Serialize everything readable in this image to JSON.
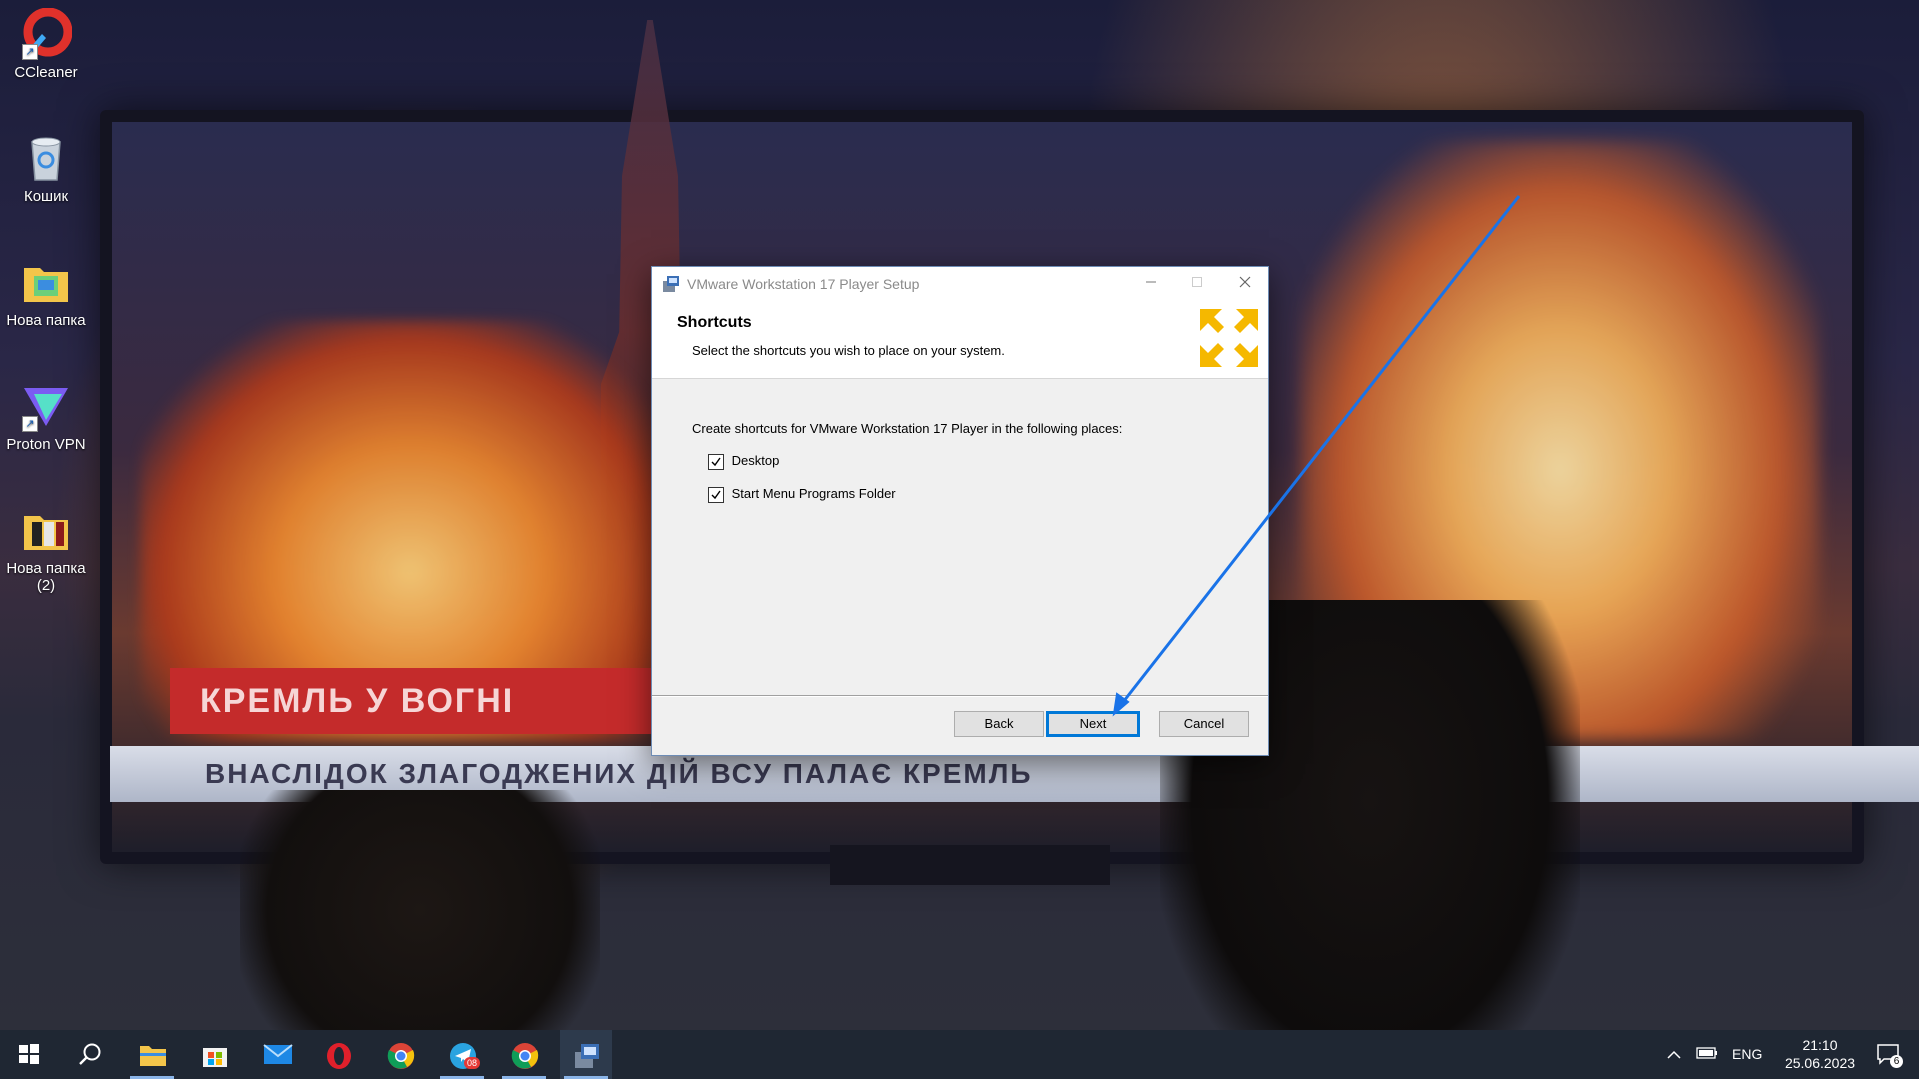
{
  "desktop": {
    "icons": [
      {
        "label": "CCleaner",
        "icon": "ccleaner-icon"
      },
      {
        "label": "Кошик",
        "icon": "recycle-bin-icon"
      },
      {
        "label": "Нова папка",
        "icon": "folder-icon"
      },
      {
        "label": "Proton VPN",
        "icon": "proton-vpn-icon"
      },
      {
        "label": "Нова папка (2)",
        "icon": "folder-icon"
      }
    ],
    "wallpaper": {
      "banner": "КРЕМЛЬ У ВОГНІ",
      "ticker": "ВНАСЛІДОК ЗЛАГОДЖЕНИХ ДІЙ ВСУ ПАЛАЄ КРЕМЛЬ"
    }
  },
  "dialog": {
    "title": "VMware Workstation 17 Player Setup",
    "header_title": "Shortcuts",
    "header_subtitle": "Select the shortcuts you wish to place on your system.",
    "lead": "Create shortcuts for VMware Workstation 17 Player in the following places:",
    "options": [
      {
        "label": "Desktop",
        "checked": true
      },
      {
        "label": "Start Menu Programs Folder",
        "checked": true
      }
    ],
    "buttons": {
      "back": "Back",
      "next": "Next",
      "cancel": "Cancel"
    }
  },
  "taskbar": {
    "language": "ENG",
    "time": "21:10",
    "date": "25.06.2023",
    "telegram_badge": "08",
    "notification_count": "6"
  },
  "colors": {
    "accent": "#0078d7",
    "annotation_arrow": "#1a73e8",
    "taskbar": "#1f2733",
    "vmware_logo": "#f5b800"
  }
}
